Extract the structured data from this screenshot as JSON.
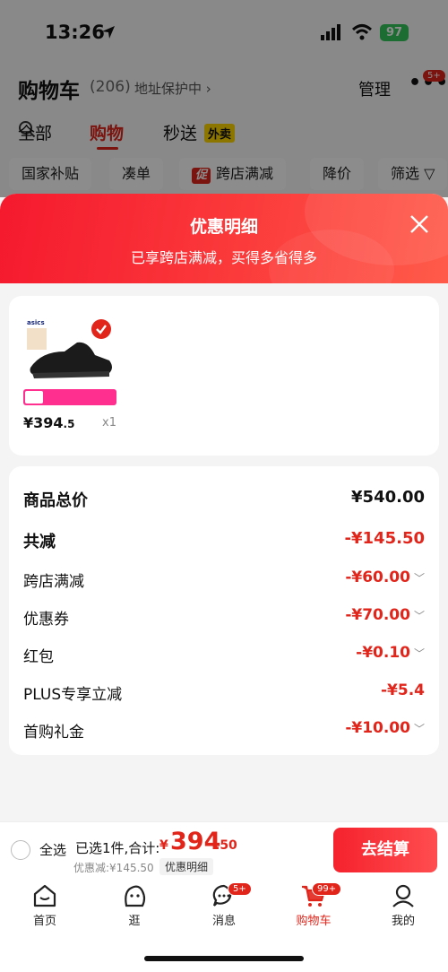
{
  "status_bar": {
    "time": "13:26",
    "battery": "97"
  },
  "header": {
    "title": "购物车",
    "count": "(206)",
    "address": "地址保护中 ›",
    "manage": "管理",
    "more": "•••",
    "more_badge": "5+"
  },
  "tabs": {
    "all": "全部",
    "shopping": "购物",
    "flash": "秒送",
    "flash_badge": "外卖"
  },
  "filters": [
    "国家补贴",
    "凑单",
    "跨店满减",
    "降价",
    "筛选"
  ],
  "filter_promo_tag": "促",
  "sheet": {
    "title": "优惠明细",
    "subtitle": "已享跨店满减，买得多省得多",
    "product": {
      "price_main": "¥394",
      "price_dec": ".5",
      "qty": "x1"
    },
    "rows": [
      {
        "label": "商品总价",
        "value": "¥540.00"
      },
      {
        "label": "共减",
        "value": "-¥145.50"
      },
      {
        "label": "跨店满减",
        "value": "-¥60.00"
      },
      {
        "label": "优惠券",
        "value": "-¥70.00"
      },
      {
        "label": "红包",
        "value": "-¥0.10"
      },
      {
        "label": "PLUS专享立减",
        "value": "-¥5.4"
      },
      {
        "label": "首购礼金",
        "value": "-¥10.00"
      }
    ]
  },
  "checkout": {
    "select_all": "全选",
    "selected": "已选1件,合计:",
    "currency": "¥",
    "amount": "394",
    "amount_dec": ".50",
    "saved": "优惠减:¥145.50",
    "detail": "优惠明细",
    "pay": "去结算"
  },
  "tabbar": [
    {
      "label": "首页",
      "badge": ""
    },
    {
      "label": "逛",
      "badge": ""
    },
    {
      "label": "消息",
      "badge": "5+"
    },
    {
      "label": "购物车",
      "badge": "99+"
    },
    {
      "label": "我的",
      "badge": ""
    }
  ],
  "colors": {
    "accent": "#e1251b",
    "battery": "#34c759"
  },
  "icons": [
    "location-arrow-icon",
    "signal-icon",
    "wifi-icon",
    "search-icon",
    "close-icon",
    "check-icon",
    "chevron-down-icon",
    "home-icon",
    "browse-icon",
    "message-icon",
    "cart-icon",
    "profile-icon"
  ]
}
